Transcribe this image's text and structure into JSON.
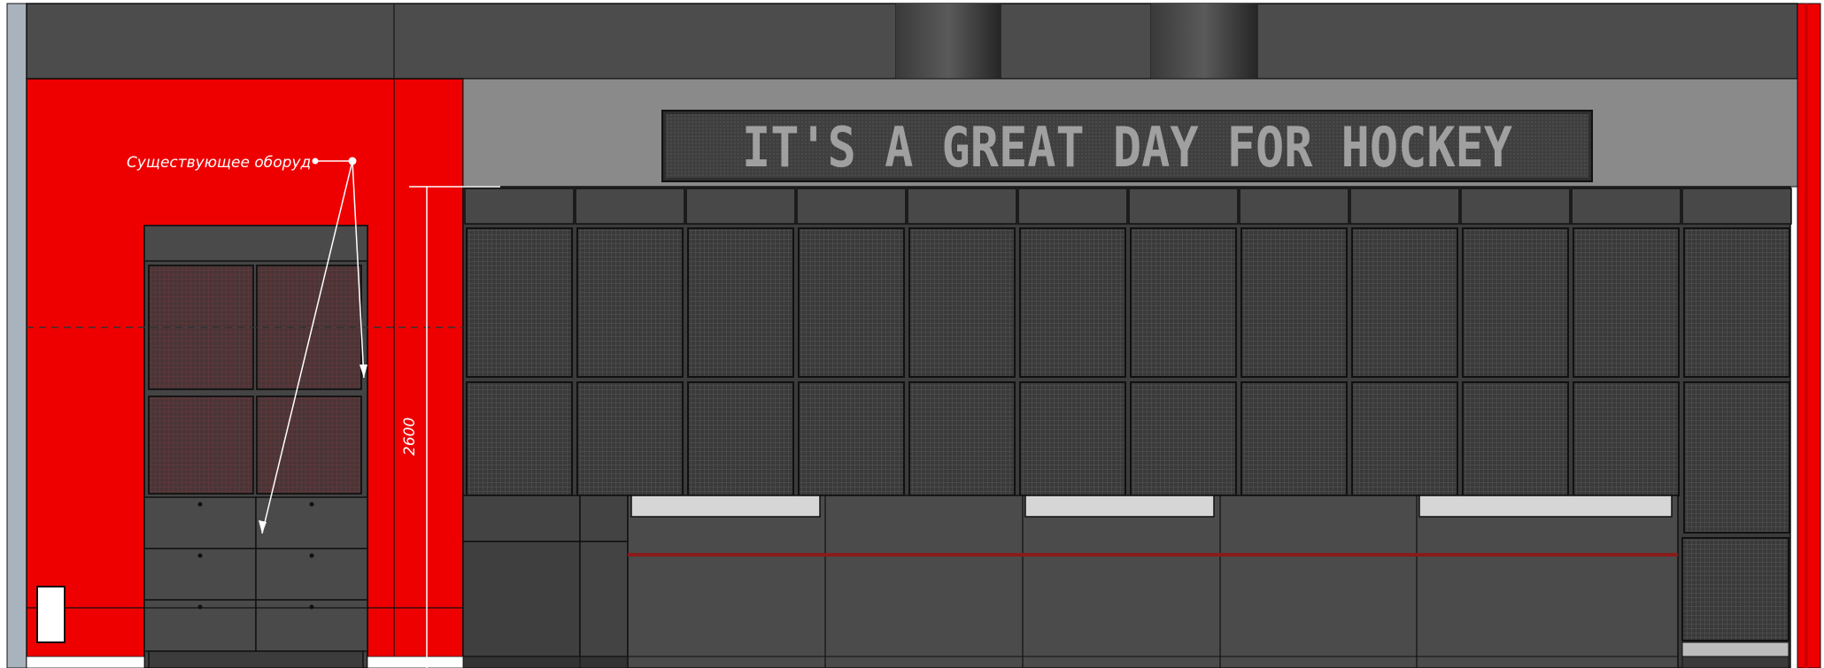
{
  "drawing": {
    "banner_text": "IT'S A GREAT DAY FOR HOCKEY",
    "callout_label": "Существующее оборуд",
    "dimension_label": "2600"
  },
  "colors": {
    "wall_red": "#ee0000",
    "wall_grey": "#8a8a8a",
    "panel_dark": "#4b4b4b",
    "panel_darker": "#3d3d3d",
    "grid_panel": "#3a3a3a",
    "grid_line": "#5a5a5a",
    "cabinet_glass": "#4a3436",
    "banner_bg": "#3f3f3f",
    "banner_text": "#9a9a9a",
    "accent_stripe": "#8b1a1a",
    "light_bar": "#d6d6d6",
    "left_wall": "#a9b3bd",
    "ceiling": "#4c4c4c",
    "outline": "#111111"
  }
}
